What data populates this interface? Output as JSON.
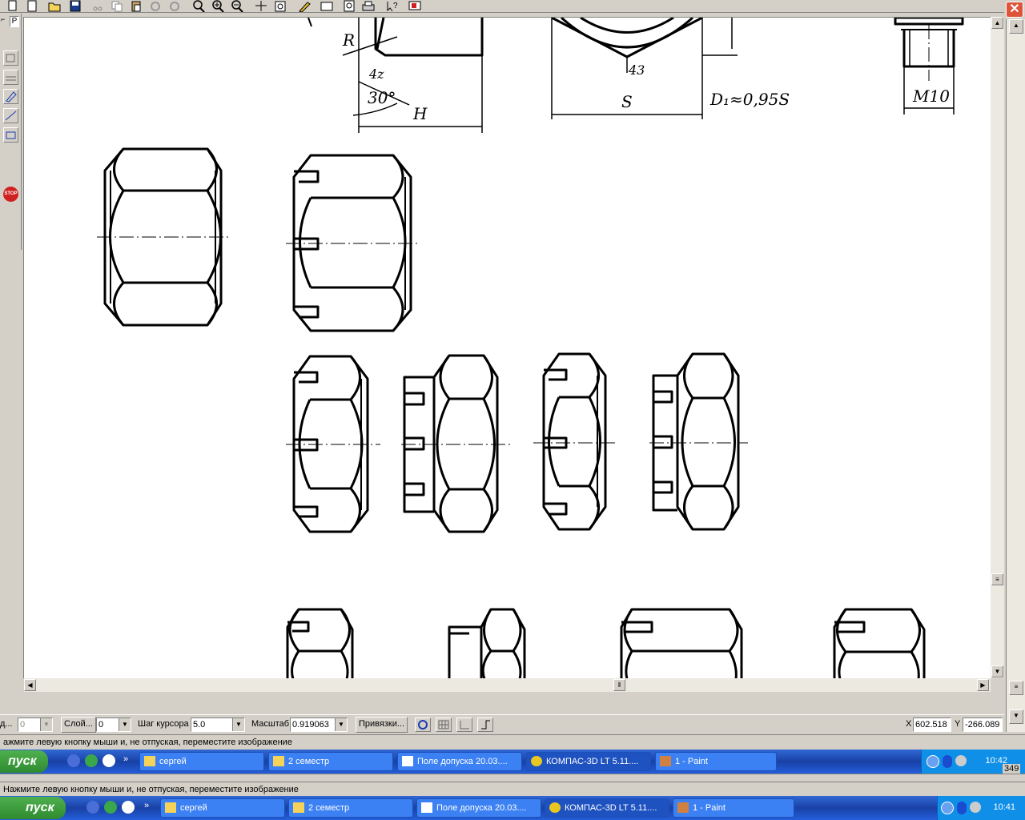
{
  "window": {
    "close_glyph": "✕"
  },
  "toolbar": {
    "icons": [
      "document-icon",
      "new-document-icon",
      "open-folder-icon",
      "save-icon",
      "cut-icon",
      "copy-icon",
      "paste-icon",
      "undo-icon",
      "redo-icon",
      "zoom-icon",
      "zoom-in-icon",
      "zoom-out-icon",
      "pan-icon",
      "zoom-window-icon",
      "pencil-icon",
      "preview-icon",
      "print-icon",
      "help-icon",
      "screen-icon"
    ],
    "partial_label": "Р"
  },
  "palette": {
    "icons": [
      "geometry-icon",
      "dimensions-icon",
      "edit-icon",
      "measure-icon",
      "select-icon",
      "stop-icon"
    ],
    "stop_label": "STOP"
  },
  "drawing": {
    "label_R": "R",
    "label_4z": "4z",
    "label_43": "43",
    "label_30": "30°",
    "label_H": "H",
    "label_S": "S",
    "label_D1": "D₁≈0,95S",
    "label_M10": "M10"
  },
  "params": {
    "field1_value": "0",
    "layer_label": "Слой...",
    "layer_value": "0",
    "step_label": "Шаг курсора",
    "step_value": "5.0",
    "scale_label": "Масштаб",
    "scale_value": "0.919063",
    "snaps_label": "Привязки...",
    "x_label": "X",
    "x_value": "602.518",
    "y_label": "Y",
    "y_value": "-266.089",
    "partial_left": "д..."
  },
  "hint1": "ажмите левую кнопку мыши и, не отпуская, переместите изображение",
  "hint2": "Нажмите левую кнопку мыши и, не отпуская, переместите изображение",
  "taskbar1": {
    "start": "пуск",
    "tasks": [
      "сергей",
      "2 семестр",
      "Поле допуска 20.03....",
      "КОМПАС-3D LT 5.11....",
      "1 - Paint"
    ],
    "clock": "10:42",
    "edge_text": "349"
  },
  "taskbar2": {
    "start": "пуск",
    "tasks": [
      "сергей",
      "2 семестр",
      "Поле допуска 20.03....",
      "КОМПАС-3D LT 5.11....",
      "1 - Paint"
    ],
    "clock": "10:41"
  },
  "colors": {
    "taskbar": "#245edb",
    "start_green": "#3c9a3c",
    "close_red": "#e0533b"
  }
}
